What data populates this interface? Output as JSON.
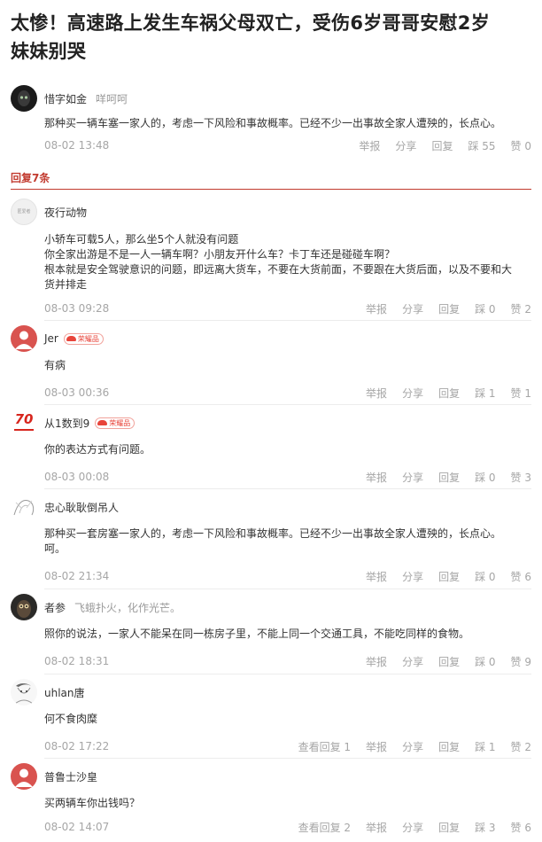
{
  "article": {
    "title_line1": "太惨！高速路上发生车祸父母双亡，受伤6岁哥哥安慰2岁",
    "title_line2": "妹妹别哭"
  },
  "top_comment": {
    "author": "惜字如金",
    "signature": "咩呵呵",
    "text": "那种买一辆车塞一家人的，考虑一下风险和事故概率。已经不少一出事故全家人遭殃的，长点心。",
    "time": "08-02 13:48",
    "actions": {
      "report": "举报",
      "share": "分享",
      "reply": "回复",
      "dislike": "踩 55",
      "like": "赞 0"
    }
  },
  "replies_header": "回复7条",
  "badge_label": "荣耀品",
  "replies": [
    {
      "author": "夜行动物",
      "avatar_text": "匿爱者",
      "lines": [
        "小轿车可载5人，那么坐5个人就没有问题",
        "你全家出游是不是一人一辆车啊？小朋友开什么车？卡丁车还是碰碰车啊？",
        "根本就是安全驾驶意识的问题，即远离大货车，不要在大货前面，不要跟在大货后面，以及不要和大",
        "货并排走"
      ],
      "time": "08-03 09:28",
      "actions": {
        "report": "举报",
        "share": "分享",
        "reply": "回复",
        "dislike": "踩 0",
        "like": "赞 2"
      }
    },
    {
      "author": "Jer",
      "lines": [
        "有病"
      ],
      "time": "08-03 00:36",
      "actions": {
        "report": "举报",
        "share": "分享",
        "reply": "回复",
        "dislike": "踩 1",
        "like": "赞 1"
      }
    },
    {
      "author": "从1数到9",
      "avatar_text": "70",
      "lines": [
        "你的表达方式有问题。"
      ],
      "time": "08-03 00:08",
      "actions": {
        "report": "举报",
        "share": "分享",
        "reply": "回复",
        "dislike": "踩 0",
        "like": "赞 3"
      }
    },
    {
      "author": "忠心耿耿倒吊人",
      "lines": [
        "那种买一套房塞一家人的，考虑一下风险和事故概率。已经不少一出事故全家人遭殃的，长点心。",
        "呵。"
      ],
      "time": "08-02 21:34",
      "actions": {
        "report": "举报",
        "share": "分享",
        "reply": "回复",
        "dislike": "踩 0",
        "like": "赞 6"
      }
    },
    {
      "author": "者参",
      "signature": "飞蛾扑火，化作光芒。",
      "lines": [
        "照你的说法，一家人不能呆在同一栋房子里，不能上同一个交通工具，不能吃同样的食物。"
      ],
      "time": "08-02 18:31",
      "actions": {
        "report": "举报",
        "share": "分享",
        "reply": "回复",
        "dislike": "踩 0",
        "like": "赞 9"
      }
    },
    {
      "author": "uhlan唐",
      "lines": [
        "何不食肉糜"
      ],
      "time": "08-02 17:22",
      "actions": {
        "view": "查看回复 1",
        "report": "举报",
        "share": "分享",
        "reply": "回复",
        "dislike": "踩 1",
        "like": "赞 2"
      }
    },
    {
      "author": "普鲁士沙皇",
      "lines": [
        "买两辆车你出钱吗？"
      ],
      "time": "08-02 14:07",
      "actions": {
        "view": "查看回复 2",
        "report": "举报",
        "share": "分享",
        "reply": "回复",
        "dislike": "踩 3",
        "like": "赞 6"
      }
    }
  ]
}
